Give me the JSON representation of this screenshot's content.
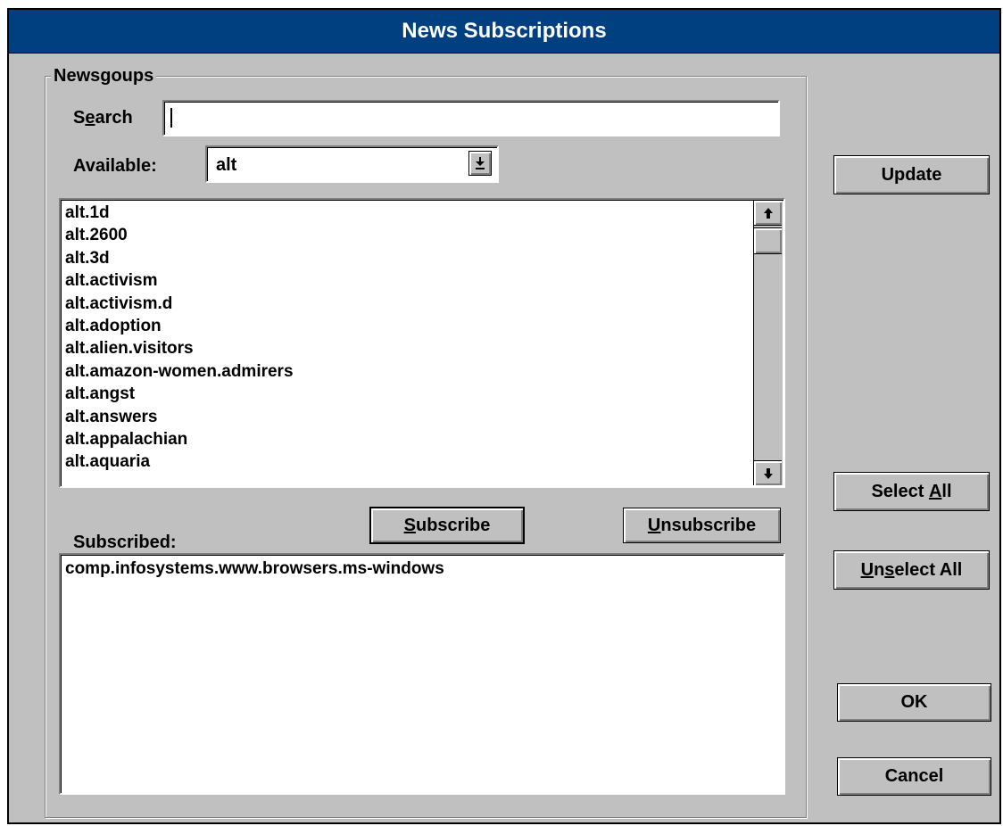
{
  "window": {
    "title": "News Subscriptions"
  },
  "newsgroups": {
    "group_label": "Newsgoups",
    "search": {
      "label_pre": "S",
      "label_accel": "e",
      "label_post": "arch",
      "value": ""
    },
    "available": {
      "label": "Available:",
      "selected": "alt"
    },
    "list": [
      "alt.1d",
      "alt.2600",
      "alt.3d",
      "alt.activism",
      "alt.activism.d",
      "alt.adoption",
      "alt.alien.visitors",
      "alt.amazon-women.admirers",
      "alt.angst",
      "alt.answers",
      "alt.appalachian",
      "alt.aquaria"
    ],
    "subscribe_button": {
      "accel": "S",
      "rest": "ubscribe"
    },
    "unsubscribe_button": {
      "accel": "U",
      "rest": "nsubscribe"
    },
    "subscribed_label": "Subscribed:",
    "subscribed": [
      "comp.infosystems.www.browsers.ms-windows"
    ]
  },
  "side_buttons": {
    "update": "Update",
    "select_all": {
      "pre": "Select ",
      "accel": "A",
      "post": "ll"
    },
    "unselect_all": {
      "accel": "U",
      "mid": "n",
      "accel2": "s",
      "post": "elect All"
    },
    "ok": "OK",
    "cancel": "Cancel"
  },
  "icons": {
    "dropdown": "dropdown-arrow-icon",
    "scroll_up": "scroll-up-arrow-icon",
    "scroll_down": "scroll-down-arrow-icon"
  },
  "colors": {
    "titlebar": "#004080",
    "face": "#c0c0c0",
    "text": "#000000"
  }
}
